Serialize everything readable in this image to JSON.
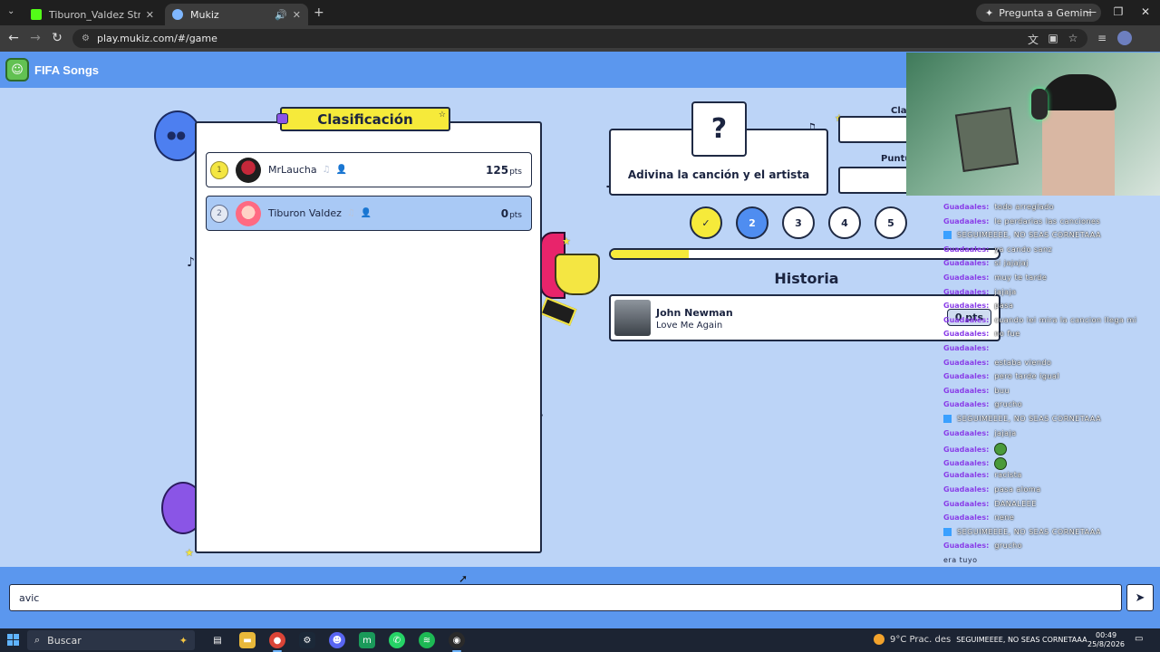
{
  "browser": {
    "tabs": [
      {
        "title": "Tiburon_Valdez Stream - Watch",
        "active": false
      },
      {
        "title": "Mukiz",
        "active": true
      }
    ],
    "gemini_label": "Pregunta a Gemini",
    "url": "play.mukiz.com/#/game"
  },
  "app": {
    "title": "FIFA Songs"
  },
  "leaderboard": {
    "title": "Clasificación",
    "players": [
      {
        "rank": "1",
        "name": "MrLaucha",
        "score": "125",
        "unit": "pts",
        "highlight": false
      },
      {
        "rank": "2",
        "name": "Tiburon Valdez",
        "score": "0",
        "unit": "pts",
        "highlight": true
      }
    ]
  },
  "game": {
    "question_mark": "?",
    "prompt": "Adivina la canción y el artista",
    "side_labels": [
      "Cla",
      "Puntu"
    ],
    "rounds": [
      {
        "label": "✓",
        "state": "done"
      },
      {
        "label": "2",
        "state": "current"
      },
      {
        "label": "3",
        "state": "pending"
      },
      {
        "label": "4",
        "state": "pending"
      },
      {
        "label": "5",
        "state": "pending"
      }
    ],
    "progress_percent": 20,
    "history_title": "Historia",
    "history": [
      {
        "artist": "John Newman",
        "song": "Love Me Again",
        "points": "0 pts"
      }
    ]
  },
  "chat": {
    "messages": [
      {
        "user": "Guadaales:",
        "text": "todo arreglado",
        "kind": "user"
      },
      {
        "user": "Guadaales:",
        "text": "le perdarias las canciones",
        "kind": "user"
      },
      {
        "user": "",
        "text": "SEGUIMEEEE, NO SEAS CORNETAAA",
        "kind": "bot"
      },
      {
        "user": "Guadaales:",
        "text": "ya cando sanz",
        "kind": "user"
      },
      {
        "user": "Guadaales:",
        "text": "si jajajaj",
        "kind": "user"
      },
      {
        "user": "Guadaales:",
        "text": "muy te tarde",
        "kind": "user"
      },
      {
        "user": "Guadaales:",
        "text": "jajaja",
        "kind": "user"
      },
      {
        "user": "Guadaales:",
        "text": "pasa",
        "kind": "user"
      },
      {
        "user": "Guadaales:",
        "text": "cuando lei mira la cancion llega mi",
        "kind": "user"
      },
      {
        "user": "Guadaales:",
        "text": "no fue",
        "kind": "user"
      },
      {
        "user": "Guadaales:",
        "text": "",
        "kind": "user"
      },
      {
        "user": "Guadaales:",
        "text": "estaba viendo",
        "kind": "user"
      },
      {
        "user": "Guadaales:",
        "text": "pero tarde igual",
        "kind": "user"
      },
      {
        "user": "Guadaales:",
        "text": "buu",
        "kind": "user"
      },
      {
        "user": "Guadaales:",
        "text": "grucho",
        "kind": "user"
      },
      {
        "user": "",
        "text": "SEGUIMEEEE, NO SEAS CORNETAAA",
        "kind": "bot"
      },
      {
        "user": "Guadaales:",
        "text": "jajaja",
        "kind": "user"
      },
      {
        "user": "Guadaales:",
        "text": "",
        "kind": "emote"
      },
      {
        "user": "Guadaales:",
        "text": "",
        "kind": "emote"
      },
      {
        "user": "Guadaales:",
        "text": "racista",
        "kind": "user"
      },
      {
        "user": "Guadaales:",
        "text": "pasa aloma",
        "kind": "user"
      },
      {
        "user": "Guadaales:",
        "text": "DANALEEE",
        "kind": "user"
      },
      {
        "user": "Guadaales:",
        "text": "nene",
        "kind": "user"
      },
      {
        "user": "",
        "text": "SEGUIMEEEE, NO SEAS CORNETAAA",
        "kind": "bot"
      },
      {
        "user": "Guadaales:",
        "text": "grucho",
        "kind": "user"
      },
      {
        "user": "",
        "text": "era tuyo",
        "kind": "user"
      },
      {
        "user": "Guadaales:",
        "text": "vamos",
        "kind": "user"
      },
      {
        "user": "Guadaales:",
        "text": "",
        "kind": "emote"
      }
    ]
  },
  "guess": {
    "value": "avic",
    "send_icon": "send-arrow-icon"
  },
  "taskbar": {
    "search_label": "Buscar",
    "weather": "9°C  Prac. des",
    "bottom_bot": "SEGUIMEEEE, NO SEAS CORNETAAA",
    "time": "00:49",
    "date": "25/8/2026"
  },
  "colors": {
    "page_bg": "#bcd4f7",
    "header_bg": "#5b97ee",
    "accent_yellow": "#f6ea3a",
    "current_round": "#4f8df0",
    "ink": "#1b2440"
  }
}
